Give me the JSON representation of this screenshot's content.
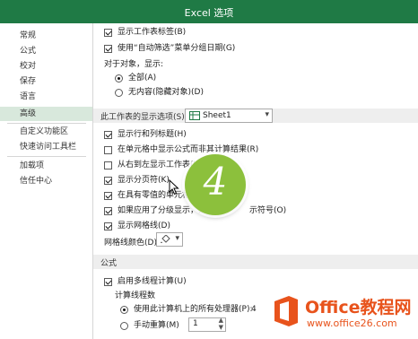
{
  "window": {
    "title": "Excel 选项"
  },
  "sidebar": {
    "items": [
      "常规",
      "公式",
      "校对",
      "保存",
      "语言",
      "高级",
      "自定义功能区",
      "快速访问工具栏",
      "加载项",
      "信任中心"
    ],
    "active_index": 5
  },
  "options": {
    "show_sheet_tabs": {
      "label": "显示工作表标签(B)",
      "checked": true
    },
    "group_dates": {
      "label": "使用“自动筛选”菜单分组日期(G)",
      "checked": true
    },
    "objects_header": "对于对象，显示:",
    "radio_all": {
      "label": "全部(A)",
      "selected": true
    },
    "radio_none": {
      "label": "无内容(隐藏对象)(D)",
      "selected": false
    }
  },
  "sheet_section": {
    "title": "此工作表的显示选项(S):",
    "combo_value": "Sheet1",
    "items": [
      {
        "label": "显示行和列标题(H)",
        "checked": true
      },
      {
        "label": "在单元格中显示公式而非其计算结果(R)",
        "checked": false
      },
      {
        "label": "从右到左显示工作表(W)",
        "checked": false
      },
      {
        "label": "显示分页符(K)",
        "checked": true
      },
      {
        "label": "在具有零值的单元格中",
        "checked": true
      },
      {
        "label": "如果应用了分级显示，则",
        "checked": true
      },
      {
        "label": "显示网格线(D)",
        "checked": true
      }
    ],
    "label_tail_1": "示符号(O)",
    "gridline_color_label": "网格线颜色(D)"
  },
  "formula_section": {
    "title": "公式",
    "multithread": {
      "label": "启用多线程计算(U)",
      "checked": true
    },
    "threads_header": "计算线程数",
    "use_all": {
      "label": "使用此计算机上的所有处理器(P):",
      "value": "4",
      "selected": true
    },
    "manual": {
      "label": "手动重算(M)",
      "value": "1",
      "selected": false
    }
  },
  "step_badge": {
    "number": "4"
  },
  "watermark": {
    "brand": "Office教程网",
    "url": "www.office26.com"
  },
  "colors": {
    "title_bar": "#1f7a45",
    "badge": "#8cc03c",
    "watermark_orange": "#e8531c"
  }
}
